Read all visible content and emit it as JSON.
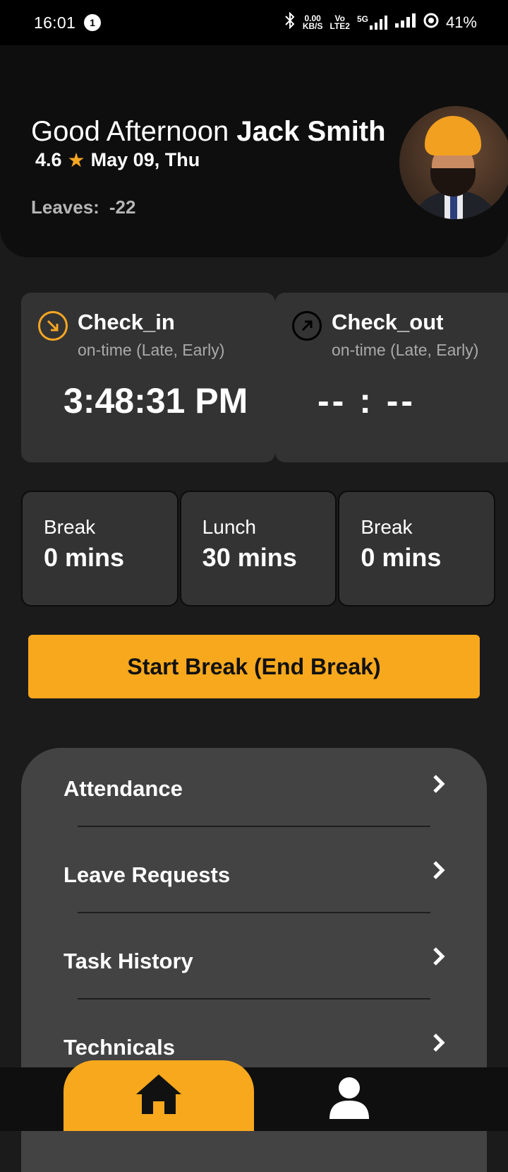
{
  "status_bar": {
    "time": "16:01",
    "notification_count": "1",
    "net_speed_top": "0.00",
    "net_speed_bottom": "KB/S",
    "volte_top": "Vo",
    "volte_bottom": "LTE2",
    "network": "5G",
    "battery": "41%"
  },
  "header": {
    "greeting": "Good Afternoon",
    "name": "Jack Smith",
    "rating": "4.6",
    "date": "May 09, Thu",
    "leaves_label": "Leaves:",
    "leaves_value": "-22"
  },
  "check_in": {
    "title": "Check_in",
    "subtitle": "on-time (Late, Early)",
    "time": "3:48:31 PM",
    "icon": "arrow-down-right-icon"
  },
  "check_out": {
    "title": "Check_out",
    "subtitle": "on-time (Late, Early)",
    "time": "-- : --",
    "icon": "arrow-up-right-icon"
  },
  "tiles": [
    {
      "label": "Break",
      "value": "0 mins"
    },
    {
      "label": "Lunch",
      "value": "30 mins"
    },
    {
      "label": "Break",
      "value": "0 mins"
    }
  ],
  "break_button": {
    "label": "Start Break (End Break)"
  },
  "menu": [
    {
      "label": "Attendance"
    },
    {
      "label": "Leave Requests"
    },
    {
      "label": "Task History"
    },
    {
      "label": "Technicals"
    }
  ],
  "colors": {
    "accent": "#f7a81d",
    "background": "#1b1b1b",
    "card": "#333333",
    "menu_card": "#434343"
  },
  "bottom_nav": {
    "home_icon": "home-icon",
    "profile_icon": "user-icon"
  }
}
